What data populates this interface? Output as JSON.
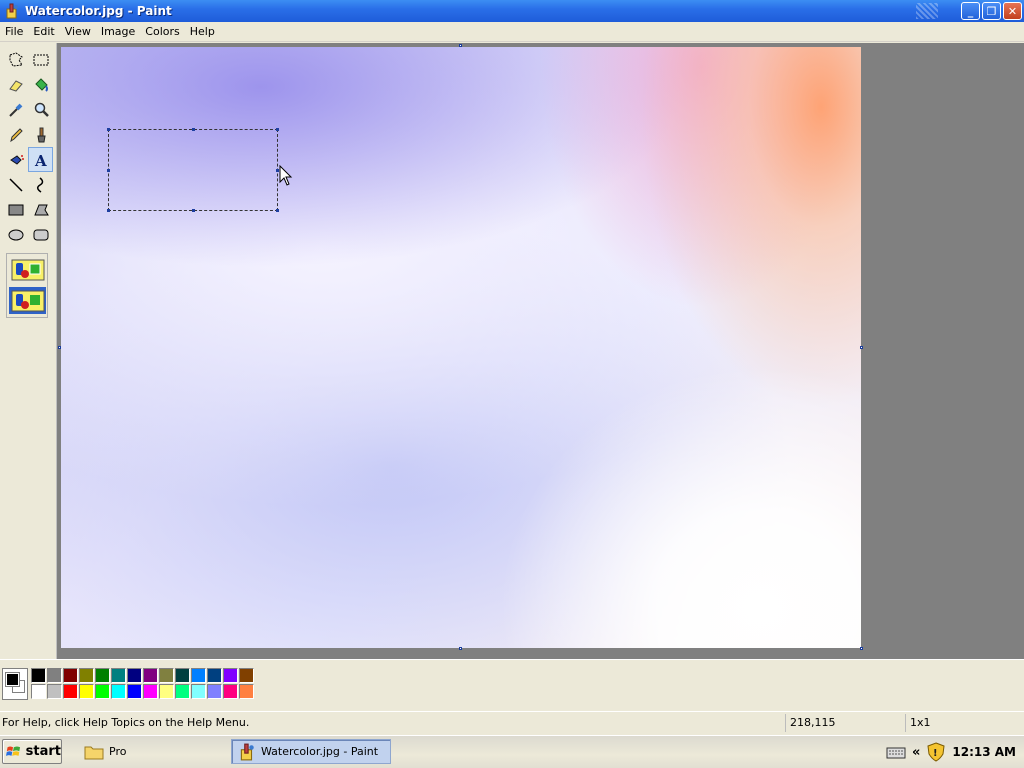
{
  "window": {
    "title": "Watercolor.jpg - Paint",
    "minimize": "_",
    "maximize": "❐",
    "close": "✕"
  },
  "menu": [
    "File",
    "Edit",
    "View",
    "Image",
    "Colors",
    "Help"
  ],
  "tools": [
    {
      "name": "free-form-select-icon"
    },
    {
      "name": "rect-select-icon"
    },
    {
      "name": "eraser-icon"
    },
    {
      "name": "fill-bucket-icon"
    },
    {
      "name": "pick-color-icon"
    },
    {
      "name": "magnifier-icon"
    },
    {
      "name": "pencil-icon"
    },
    {
      "name": "brush-icon"
    },
    {
      "name": "airbrush-icon"
    },
    {
      "name": "text-icon",
      "label": "A",
      "active": true
    },
    {
      "name": "line-icon"
    },
    {
      "name": "curve-icon"
    },
    {
      "name": "rectangle-icon"
    },
    {
      "name": "polygon-icon"
    },
    {
      "name": "ellipse-icon"
    },
    {
      "name": "rounded-rect-icon"
    }
  ],
  "palette": {
    "top": [
      "#000000",
      "#808080",
      "#800000",
      "#808000",
      "#008000",
      "#008080",
      "#000080",
      "#800080",
      "#808040",
      "#004040",
      "#0080ff",
      "#004080",
      "#8000ff",
      "#804000"
    ],
    "bottom": [
      "#ffffff",
      "#c0c0c0",
      "#ff0000",
      "#ffff00",
      "#00ff00",
      "#00ffff",
      "#0000ff",
      "#ff00ff",
      "#ffff80",
      "#00ff80",
      "#80ffff",
      "#8080ff",
      "#ff0080",
      "#ff8040"
    ],
    "foreground": "#000000",
    "background": "#ffffff"
  },
  "status": {
    "help": "For Help, click Help Topics on the Help Menu.",
    "coordinates": "218,115",
    "size": "1x1"
  },
  "taskbar": {
    "start": "start",
    "items": [
      {
        "label": "Pro"
      },
      {
        "label": "Watercolor.jpg - Paint",
        "active": true
      }
    ],
    "clock": "12:13 AM",
    "tray_chevron": "«"
  }
}
